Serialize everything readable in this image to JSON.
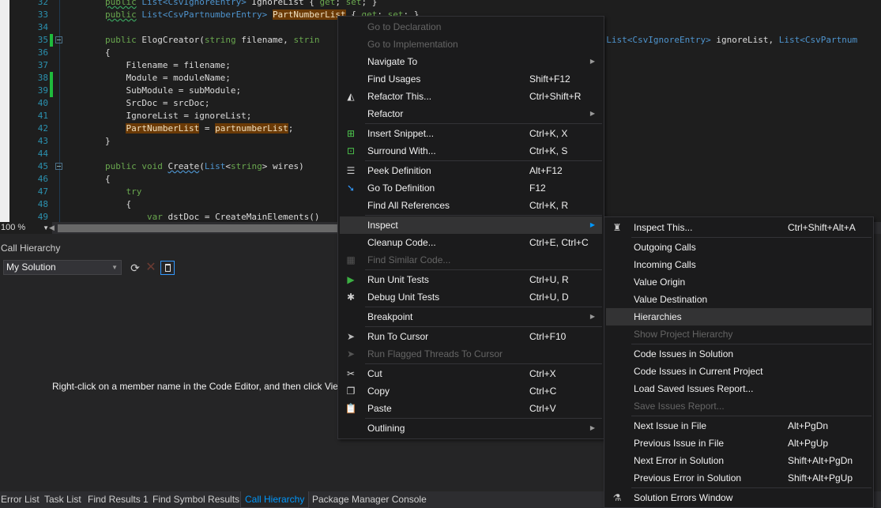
{
  "editor": {
    "lines": [
      {
        "n": "32",
        "segs": [
          [
            "kw sq",
            "public"
          ],
          [
            "id",
            " "
          ],
          [
            "ty",
            "List<CsvIgnoreEntry>"
          ],
          [
            "id",
            " IgnoreList { "
          ],
          [
            "kw",
            "get"
          ],
          [
            "id",
            "; "
          ],
          [
            "kw",
            "set"
          ],
          [
            "id",
            "; }"
          ]
        ]
      },
      {
        "n": "33",
        "segs": [
          [
            "kw sq",
            "public"
          ],
          [
            "id",
            " "
          ],
          [
            "ty",
            "List<CsvPartnumberEntry>"
          ],
          [
            "id",
            " "
          ],
          [
            "hl",
            "PartNumberList"
          ],
          [
            "id",
            " { "
          ],
          [
            "kw",
            "get"
          ],
          [
            "id",
            "; "
          ],
          [
            "kw",
            "set"
          ],
          [
            "id",
            "; }"
          ]
        ]
      },
      {
        "n": "34",
        "segs": []
      },
      {
        "n": "35",
        "segs": [
          [
            "kw",
            "public"
          ],
          [
            "id",
            " ElogCreator("
          ],
          [
            "kw",
            "string"
          ],
          [
            "id",
            " filename, "
          ],
          [
            "kw",
            "strin"
          ]
        ],
        "tail": [
          [
            "id",
            ", "
          ],
          [
            "ty",
            "List<CsvIgnoreEntry>"
          ],
          [
            "id",
            " ignoreList, "
          ],
          [
            "ty",
            "List<CsvPartnum"
          ]
        ]
      },
      {
        "n": "36",
        "segs": [
          [
            "id",
            "{"
          ]
        ]
      },
      {
        "n": "37",
        "segs": [
          [
            "id",
            "    Filename = filename;"
          ]
        ]
      },
      {
        "n": "38",
        "segs": [
          [
            "id",
            "    Module = moduleName;"
          ]
        ]
      },
      {
        "n": "39",
        "segs": [
          [
            "id",
            "    SubModule = subModule;"
          ]
        ]
      },
      {
        "n": "40",
        "segs": [
          [
            "id",
            "    SrcDoc = srcDoc;"
          ]
        ]
      },
      {
        "n": "41",
        "segs": [
          [
            "id",
            "    IgnoreList = ignoreList;"
          ]
        ]
      },
      {
        "n": "42",
        "segs": [
          [
            "id",
            "    "
          ],
          [
            "hl",
            "PartNumberList"
          ],
          [
            "id",
            " = "
          ],
          [
            "hl",
            "partnumberList"
          ],
          [
            "id",
            ";"
          ]
        ]
      },
      {
        "n": "43",
        "segs": [
          [
            "id",
            "}"
          ]
        ]
      },
      {
        "n": "44",
        "segs": []
      },
      {
        "n": "45",
        "segs": [
          [
            "kw",
            "public"
          ],
          [
            "id",
            " "
          ],
          [
            "kw",
            "void"
          ],
          [
            "id",
            " "
          ],
          [
            "id sqb",
            "Create"
          ],
          [
            "id",
            "("
          ],
          [
            "ty",
            "List"
          ],
          [
            "id",
            "<"
          ],
          [
            "kw",
            "string"
          ],
          [
            "id",
            "> wires)"
          ]
        ]
      },
      {
        "n": "46",
        "segs": [
          [
            "id",
            "{"
          ]
        ]
      },
      {
        "n": "47",
        "segs": [
          [
            "kw",
            "    try"
          ]
        ]
      },
      {
        "n": "48",
        "segs": [
          [
            "id",
            "    {"
          ]
        ]
      },
      {
        "n": "49",
        "segs": [
          [
            "kw",
            "        var"
          ],
          [
            "id",
            " dstDoc = CreateMainElements()"
          ]
        ]
      }
    ],
    "zoom_level": "100 %"
  },
  "panel": {
    "title": "Call Hierarchy",
    "scope": "My Solution",
    "hint": "Right-click on a member name in the Code Editor, and then click Vie"
  },
  "tabs": [
    {
      "label": "Error List"
    },
    {
      "label": "Task List"
    },
    {
      "label": "Find Results 1"
    },
    {
      "label": "Find Symbol Results"
    },
    {
      "label": "Call Hierarchy",
      "active": true
    },
    {
      "label": "Package Manager Console"
    }
  ],
  "context_menu": {
    "items": [
      {
        "label": "Go to Declaration",
        "disabled": true
      },
      {
        "label": "Go to Implementation",
        "disabled": true
      },
      {
        "label": "Navigate To",
        "submenu": true
      },
      {
        "label": "Find Usages",
        "shortcut": "Shift+F12"
      },
      {
        "label": "Refactor This...",
        "shortcut": "Ctrl+Shift+R",
        "icon": "refactor-icon"
      },
      {
        "label": "Refactor",
        "submenu": true
      },
      {
        "sep": true
      },
      {
        "label": "Insert Snippet...",
        "shortcut": "Ctrl+K, X",
        "icon": "insert-snippet-icon"
      },
      {
        "label": "Surround With...",
        "shortcut": "Ctrl+K, S",
        "icon": "surround-icon"
      },
      {
        "sep": true
      },
      {
        "label": "Peek Definition",
        "shortcut": "Alt+F12",
        "icon": "peek-icon"
      },
      {
        "label": "Go To Definition",
        "shortcut": "F12",
        "icon": "goto-definition-icon"
      },
      {
        "label": "Find All References",
        "shortcut": "Ctrl+K, R"
      },
      {
        "sep": true
      },
      {
        "label": "Inspect",
        "submenu": true,
        "selected": true
      },
      {
        "label": "Cleanup Code...",
        "shortcut": "Ctrl+E, Ctrl+C"
      },
      {
        "label": "Find Similar Code...",
        "disabled": true,
        "icon": "find-similar-icon"
      },
      {
        "sep": true
      },
      {
        "label": "Run Unit Tests",
        "shortcut": "Ctrl+U, R",
        "icon": "run-icon"
      },
      {
        "label": "Debug Unit Tests",
        "shortcut": "Ctrl+U, D",
        "icon": "bug-icon"
      },
      {
        "sep": true
      },
      {
        "label": "Breakpoint",
        "submenu": true
      },
      {
        "sep": true
      },
      {
        "label": "Run To Cursor",
        "shortcut": "Ctrl+F10",
        "icon": "cursor-icon"
      },
      {
        "label": "Run Flagged Threads To Cursor",
        "disabled": true,
        "icon": "cursor-icon"
      },
      {
        "sep": true
      },
      {
        "label": "Cut",
        "shortcut": "Ctrl+X",
        "icon": "scissors-icon"
      },
      {
        "label": "Copy",
        "shortcut": "Ctrl+C",
        "icon": "copy-icon"
      },
      {
        "label": "Paste",
        "shortcut": "Ctrl+V",
        "icon": "paste-icon"
      },
      {
        "sep": true
      },
      {
        "label": "Outlining",
        "submenu": true
      }
    ]
  },
  "inspect_submenu": {
    "items": [
      {
        "label": "Inspect This...",
        "shortcut": "Ctrl+Shift+Alt+A",
        "icon": "inspector-icon"
      },
      {
        "sep": true
      },
      {
        "label": "Outgoing Calls"
      },
      {
        "label": "Incoming Calls"
      },
      {
        "label": "Value Origin"
      },
      {
        "label": "Value Destination"
      },
      {
        "label": "Hierarchies",
        "selected": true
      },
      {
        "label": "Show Project Hierarchy",
        "disabled": true
      },
      {
        "sep": true
      },
      {
        "label": "Code Issues in Solution"
      },
      {
        "label": "Code Issues in Current Project"
      },
      {
        "label": "Load Saved Issues Report..."
      },
      {
        "label": "Save Issues Report...",
        "disabled": true
      },
      {
        "sep": true
      },
      {
        "label": "Next Issue in File",
        "shortcut": "Alt+PgDn"
      },
      {
        "label": "Previous Issue in File",
        "shortcut": "Alt+PgUp"
      },
      {
        "label": "Next Error in Solution",
        "shortcut": "Shift+Alt+PgDn"
      },
      {
        "label": "Previous Error in Solution",
        "shortcut": "Shift+Alt+PgUp"
      },
      {
        "sep": true
      },
      {
        "label": "Solution Errors Window",
        "icon": "flask-icon"
      }
    ]
  },
  "colors": {
    "accent": "#0097fb",
    "keyword": "#6aa84f",
    "type": "#4e94ce",
    "highlight": "#6b3a06",
    "line_number": "#2b91af"
  }
}
